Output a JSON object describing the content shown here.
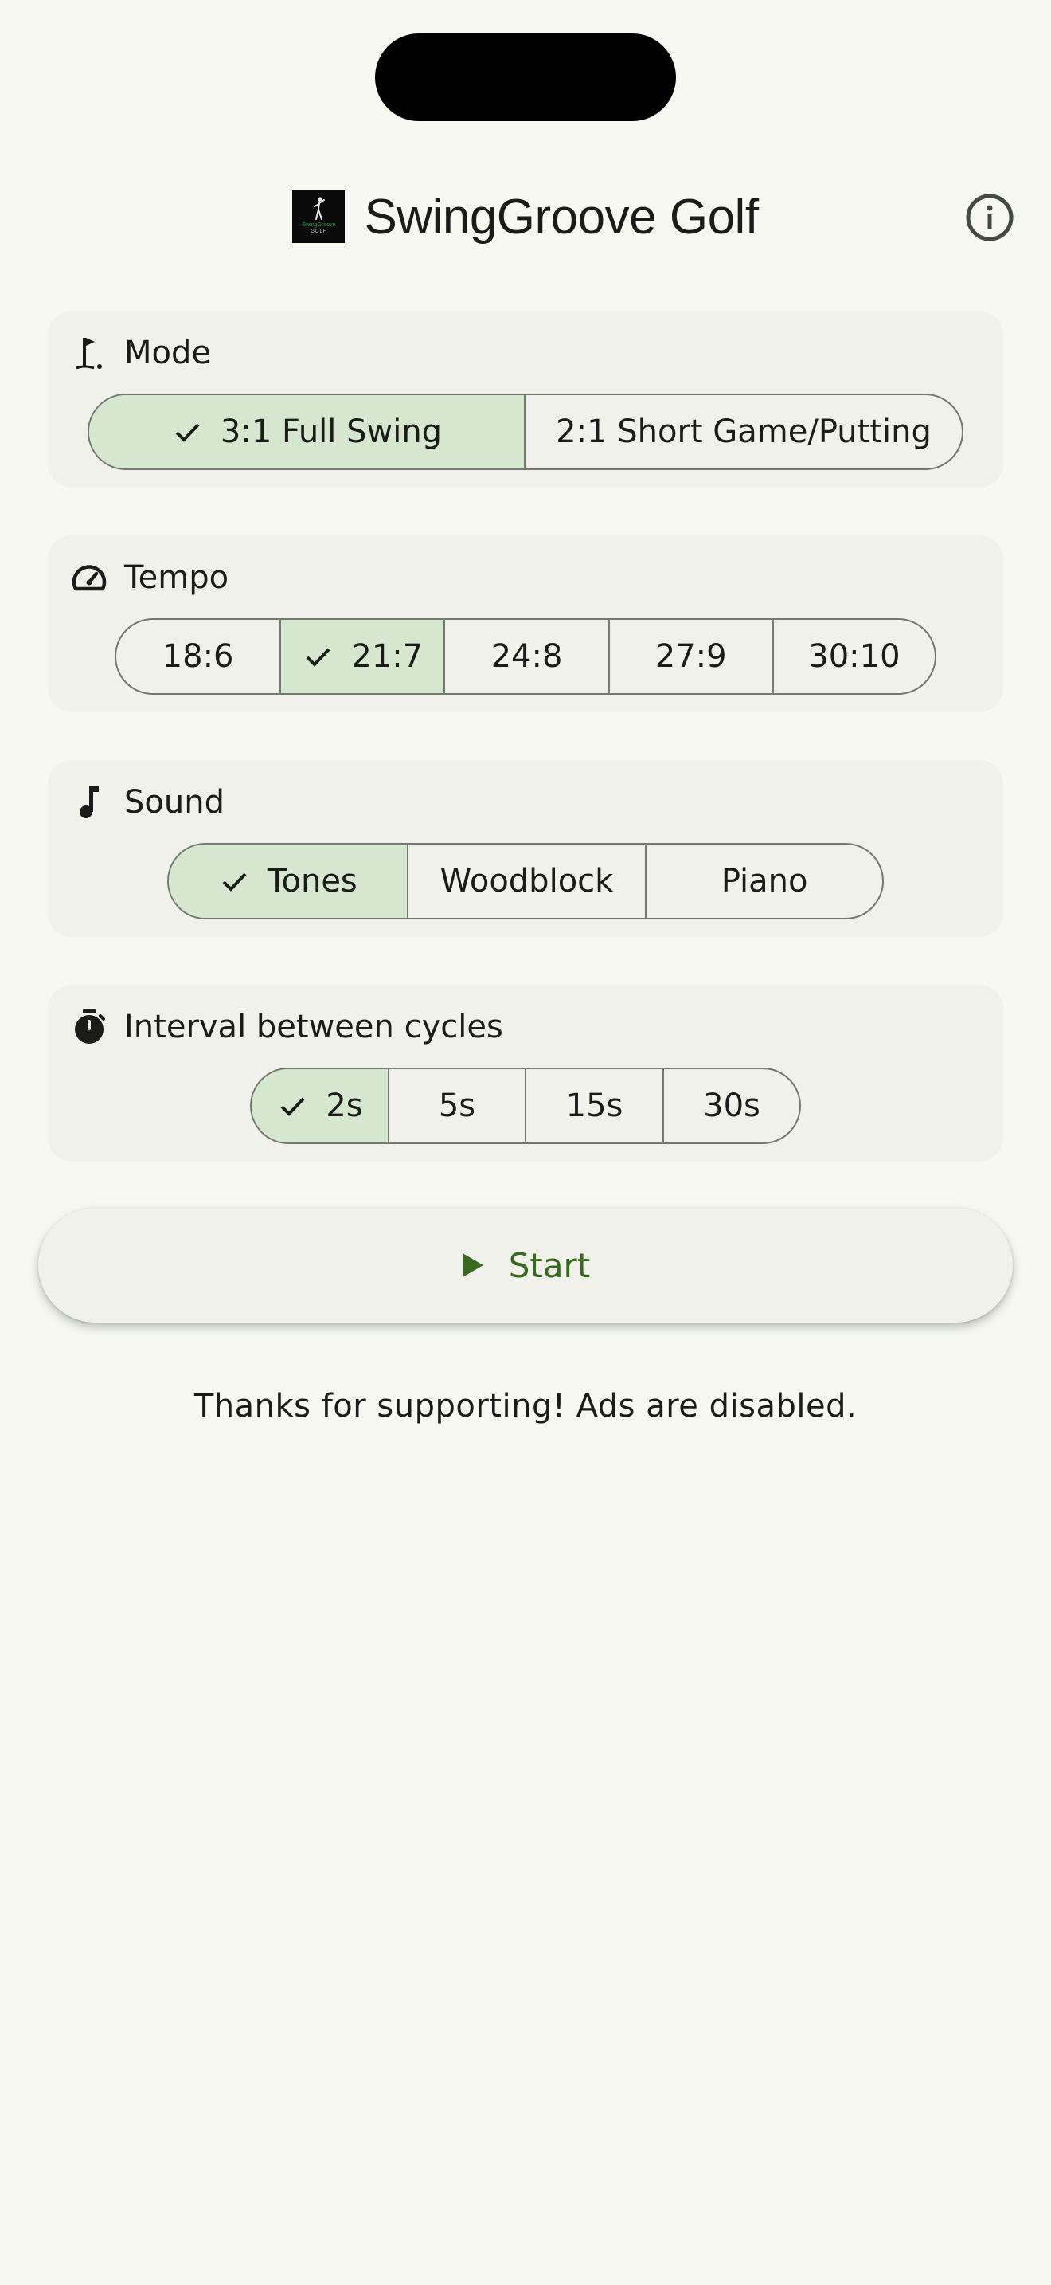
{
  "app_bar": {
    "title": "SwingGroove Golf",
    "logo_brand": "SwingGroove",
    "logo_sub": "GOLF",
    "info_icon": "info-icon"
  },
  "mode": {
    "title": "Mode",
    "icon": "golf-flag-icon",
    "options": [
      "3:1 Full Swing",
      "2:1 Short Game/Putting"
    ],
    "selected": "3:1 Full Swing"
  },
  "tempo": {
    "title": "Tempo",
    "icon": "speedometer-icon",
    "options": [
      "18:6",
      "21:7",
      "24:8",
      "27:9",
      "30:10"
    ],
    "selected": "21:7"
  },
  "sound": {
    "title": "Sound",
    "icon": "music-note-icon",
    "options": [
      "Tones",
      "Woodblock",
      "Piano"
    ],
    "selected": "Tones"
  },
  "interval": {
    "title": "Interval between cycles",
    "icon": "timer-icon",
    "options": [
      "2s",
      "5s",
      "15s",
      "30s"
    ],
    "selected": "2s"
  },
  "start": {
    "label": "Start",
    "icon": "play-icon"
  },
  "footer": {
    "message": "Thanks for supporting! Ads are disabled."
  },
  "colors": {
    "background": "#f6f8f1",
    "card": "#eff1ea",
    "selected": "#d5e8cf",
    "outline": "#74786e",
    "accent": "#386a20"
  }
}
